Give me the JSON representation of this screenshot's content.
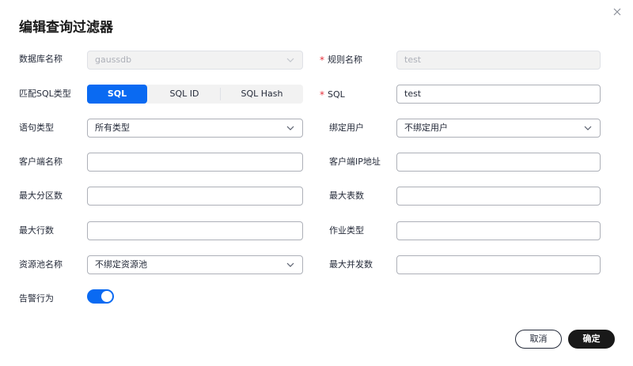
{
  "dialog": {
    "title": "编辑查询过滤器",
    "close_icon": "close-icon"
  },
  "form": {
    "database": {
      "label": "数据库名称",
      "value": "gaussdb"
    },
    "rule_name": {
      "label": "规则名称",
      "value": "test",
      "required": true
    },
    "sql_type": {
      "label": "匹配SQL类型",
      "options": [
        "SQL",
        "SQL ID",
        "SQL Hash"
      ],
      "selected": "SQL"
    },
    "sql": {
      "label": "SQL",
      "value": "test",
      "required": true
    },
    "statement_type": {
      "label": "语句类型",
      "value": "所有类型"
    },
    "bind_user": {
      "label": "绑定用户",
      "value": "不绑定用户"
    },
    "client_name": {
      "label": "客户端名称",
      "value": ""
    },
    "client_ip": {
      "label": "客户端IP地址",
      "value": ""
    },
    "max_partitions": {
      "label": "最大分区数",
      "value": ""
    },
    "max_tables": {
      "label": "最大表数",
      "value": ""
    },
    "max_rows": {
      "label": "最大行数",
      "value": ""
    },
    "job_type": {
      "label": "作业类型",
      "value": ""
    },
    "resource_pool": {
      "label": "资源池名称",
      "value": "不绑定资源池"
    },
    "max_concurrency": {
      "label": "最大并发数",
      "value": ""
    },
    "alarm": {
      "label": "告警行为",
      "enabled": true
    }
  },
  "footer": {
    "cancel_label": "取消",
    "ok_label": "确定"
  },
  "colors": {
    "accent": "#0a6af2",
    "required": "#e5323d",
    "primary_button": "#191919"
  }
}
